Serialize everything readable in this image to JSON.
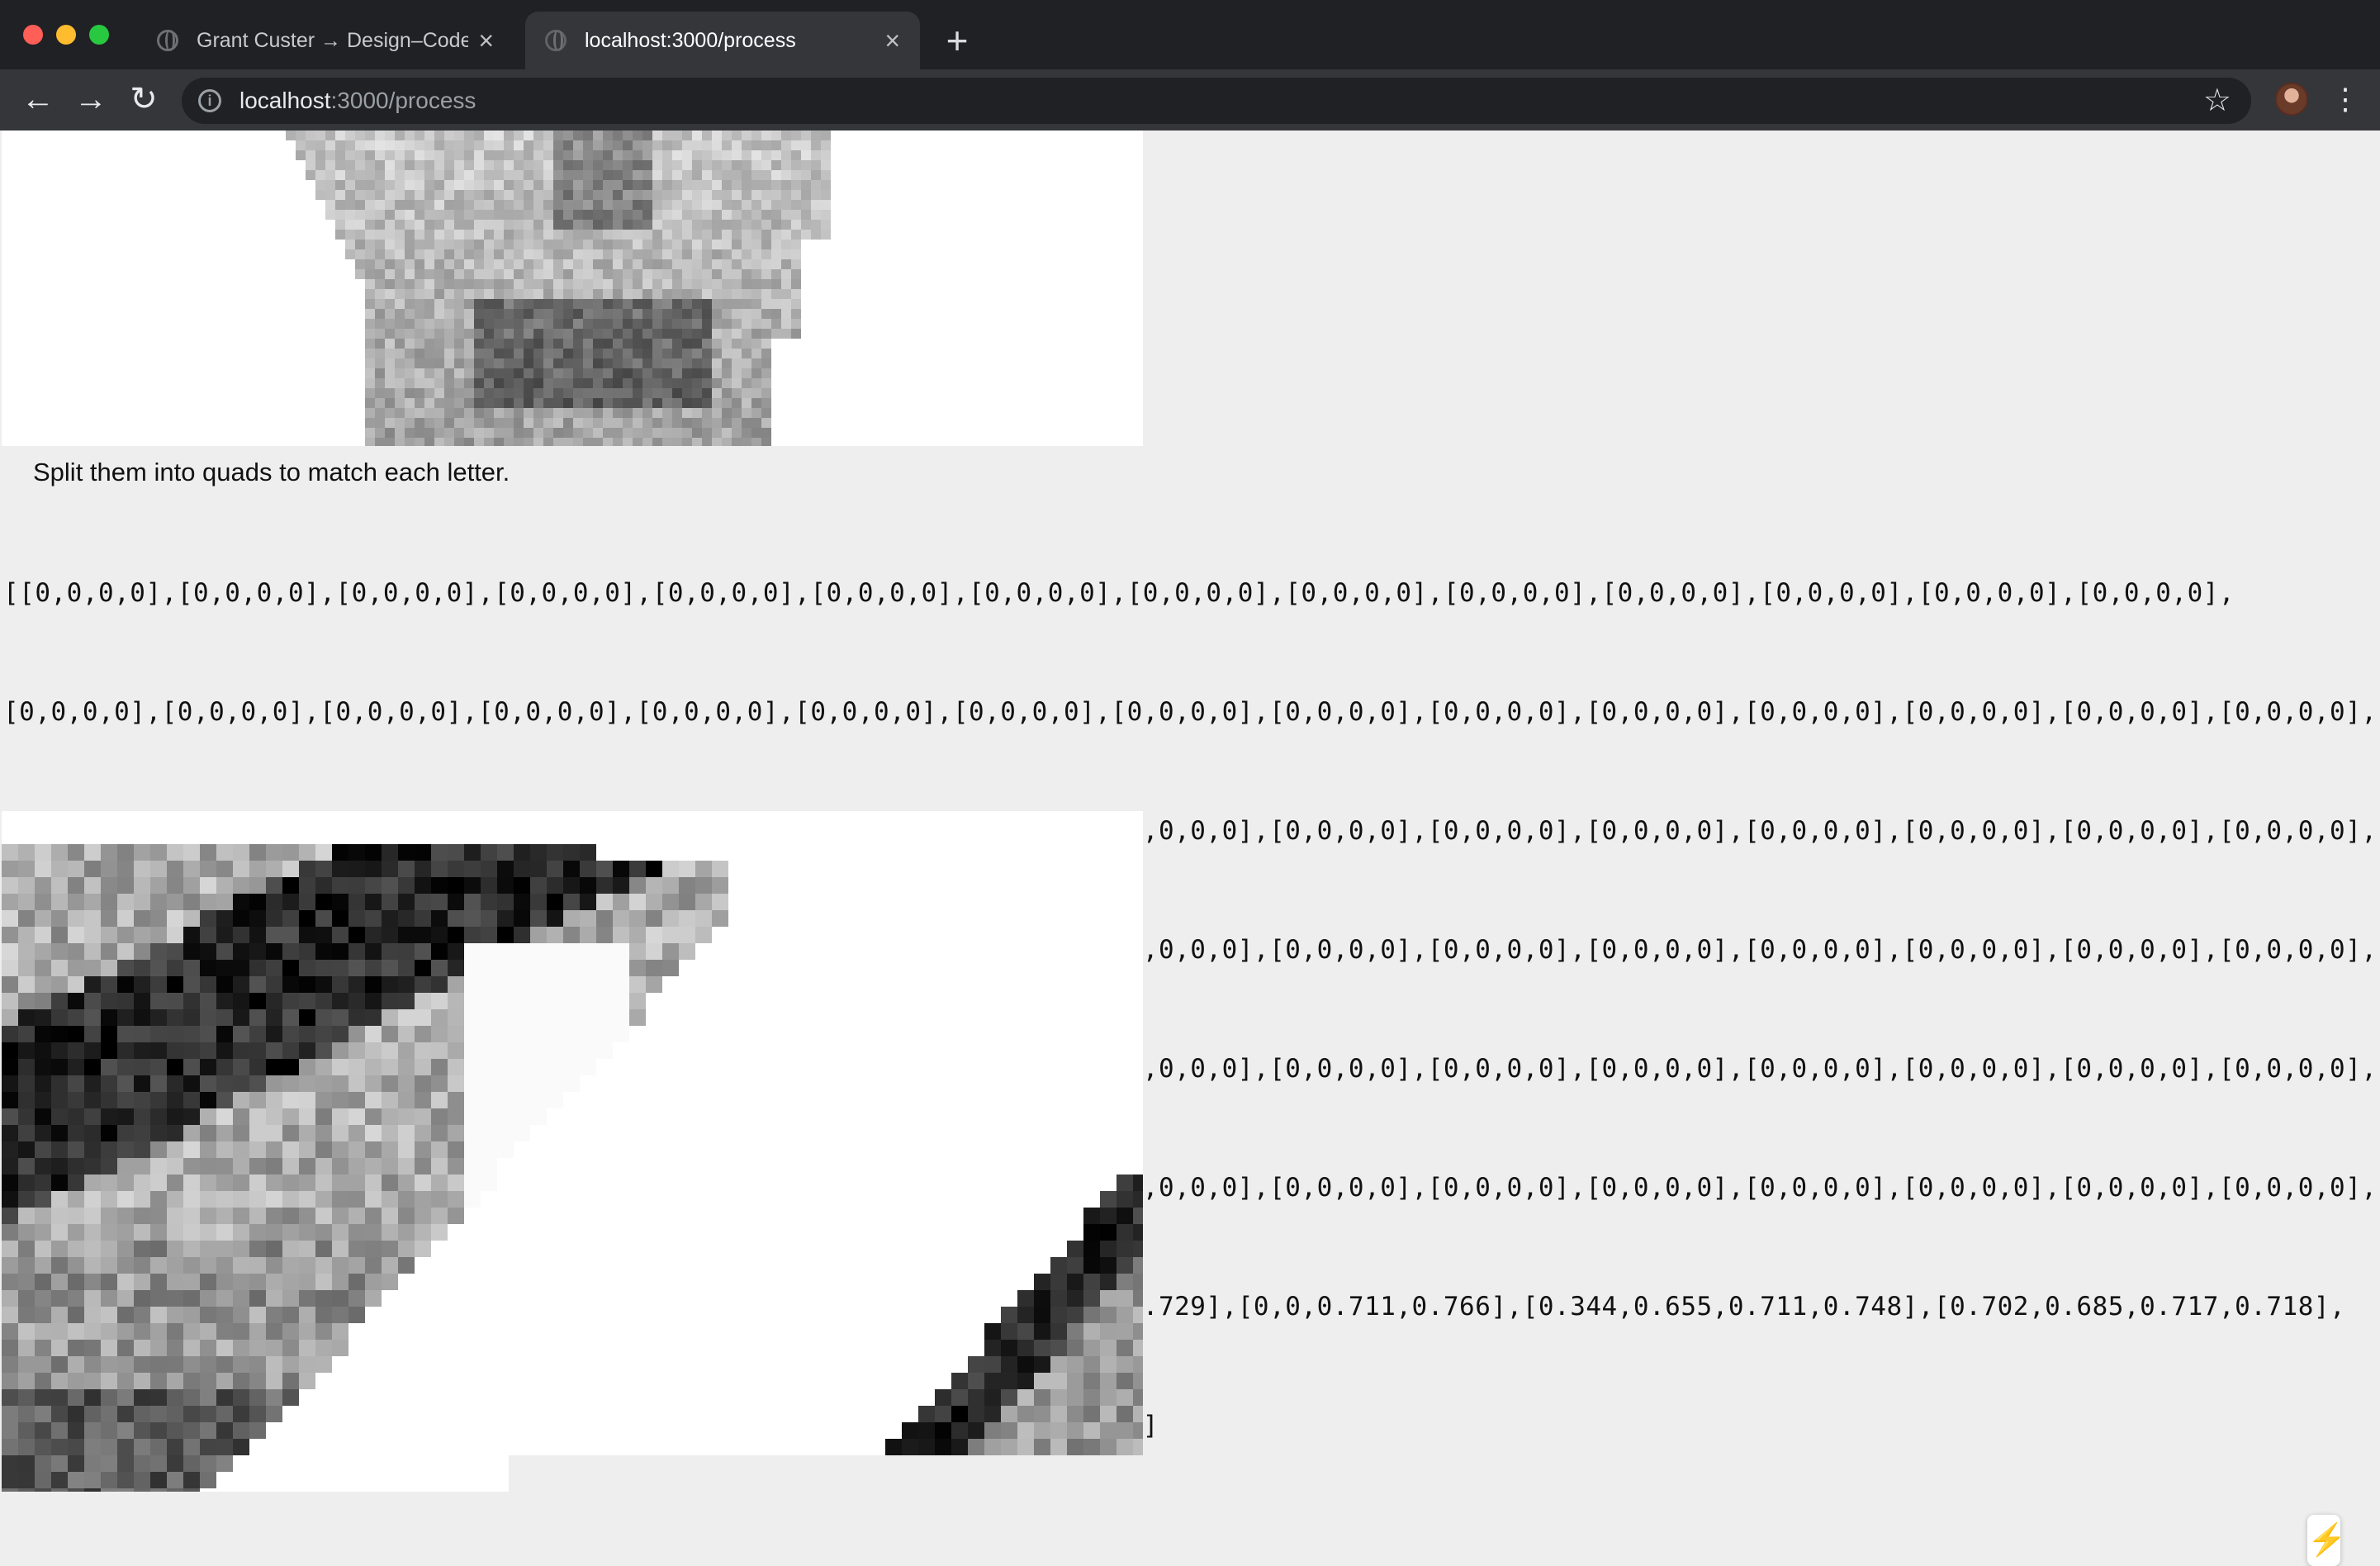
{
  "browser": {
    "tabs": [
      {
        "title": "Grant Custer → Design–Code",
        "active": false,
        "close_icon": "close-icon"
      },
      {
        "title": "localhost:3000/process",
        "active": true,
        "close_icon": "close-icon"
      }
    ],
    "new_tab_symbol": "+",
    "url_host": "localhost",
    "url_rest": ":3000/process",
    "nav": {
      "back": "←",
      "forward": "→",
      "reload": "↻"
    },
    "info_symbol": "i",
    "bookmark_symbol": "☆",
    "menu_symbol": "⋮"
  },
  "page": {
    "caption": "Split them into quads to match each letter.",
    "quad_lines": [
      "[[0,0,0,0],[0,0,0,0],[0,0,0,0],[0,0,0,0],[0,0,0,0],[0,0,0,0],[0,0,0,0],[0,0,0,0],[0,0,0,0],[0,0,0,0],[0,0,0,0],[0,0,0,0],[0,0,0,0],[0,0,0,0],",
      "[0,0,0,0],[0,0,0,0],[0,0,0,0],[0,0,0,0],[0,0,0,0],[0,0,0,0],[0,0,0,0],[0,0,0,0],[0,0,0,0],[0,0,0,0],[0,0,0,0],[0,0,0,0],[0,0,0,0],[0,0,0,0],[0,0,0,0],",
      "[0,0,0,0],[0,0,0,0],[0,0,0,0],[0,0,0,0],[0,0,0,0],[0,0,0,0],[0,0,0,0],[0,0,0,0],[0,0,0,0],[0,0,0,0],[0,0,0,0],[0,0,0,0],[0,0,0,0],[0,0,0,0],[0,0,0,0],",
      "[0,0,0,0],[0,0,0,0],[0,0,0,0],[0,0,0,0],[0,0,0,0],[0,0,0,0],[0,0,0,0],[0,0,0,0],[0,0,0,0],[0,0,0,0],[0,0,0,0],[0,0,0,0],[0,0,0,0],[0,0,0,0],[0,0,0,0],",
      "[0,0,0,0],[0,0,0,0],[0,0,0,0],[0,0,0,0],[0,0,0,0],[0,0,0,0],[0,0,0,0],[0,0,0,0],[0,0,0,0],[0,0,0,0],[0,0,0,0],[0,0,0,0],[0,0,0,0],[0,0,0,0],[0,0,0,0],",
      "[0,0,0,0],[0,0,0,0],[0,0,0,0],[0,0,0,0],[0,0,0,0],[0,0,0,0],[0,0,0,0],[0,0,0,0],[0,0,0,0],[0,0,0,0],[0,0,0,0],[0,0,0,0],[0,0,0,0],[0,0,0,0],[0,0,0,0],",
      "[0,0,0,0],[0,0,0,0.052],[0,0,0.539,0.742],[0,0,0.784,0.766],[0,0,0.743,0.729],[0,0,0.711,0.766],[0.344,0.655,0.711,0.748],[0.702,0.685,0.717,0.718],",
      "[0.599,0.566,0.677,0.547],[0.466,0.191,0.424,0.381],[0,0,0.296,0.432]...]"
    ],
    "dev_indicator_symbol": "⚡"
  }
}
